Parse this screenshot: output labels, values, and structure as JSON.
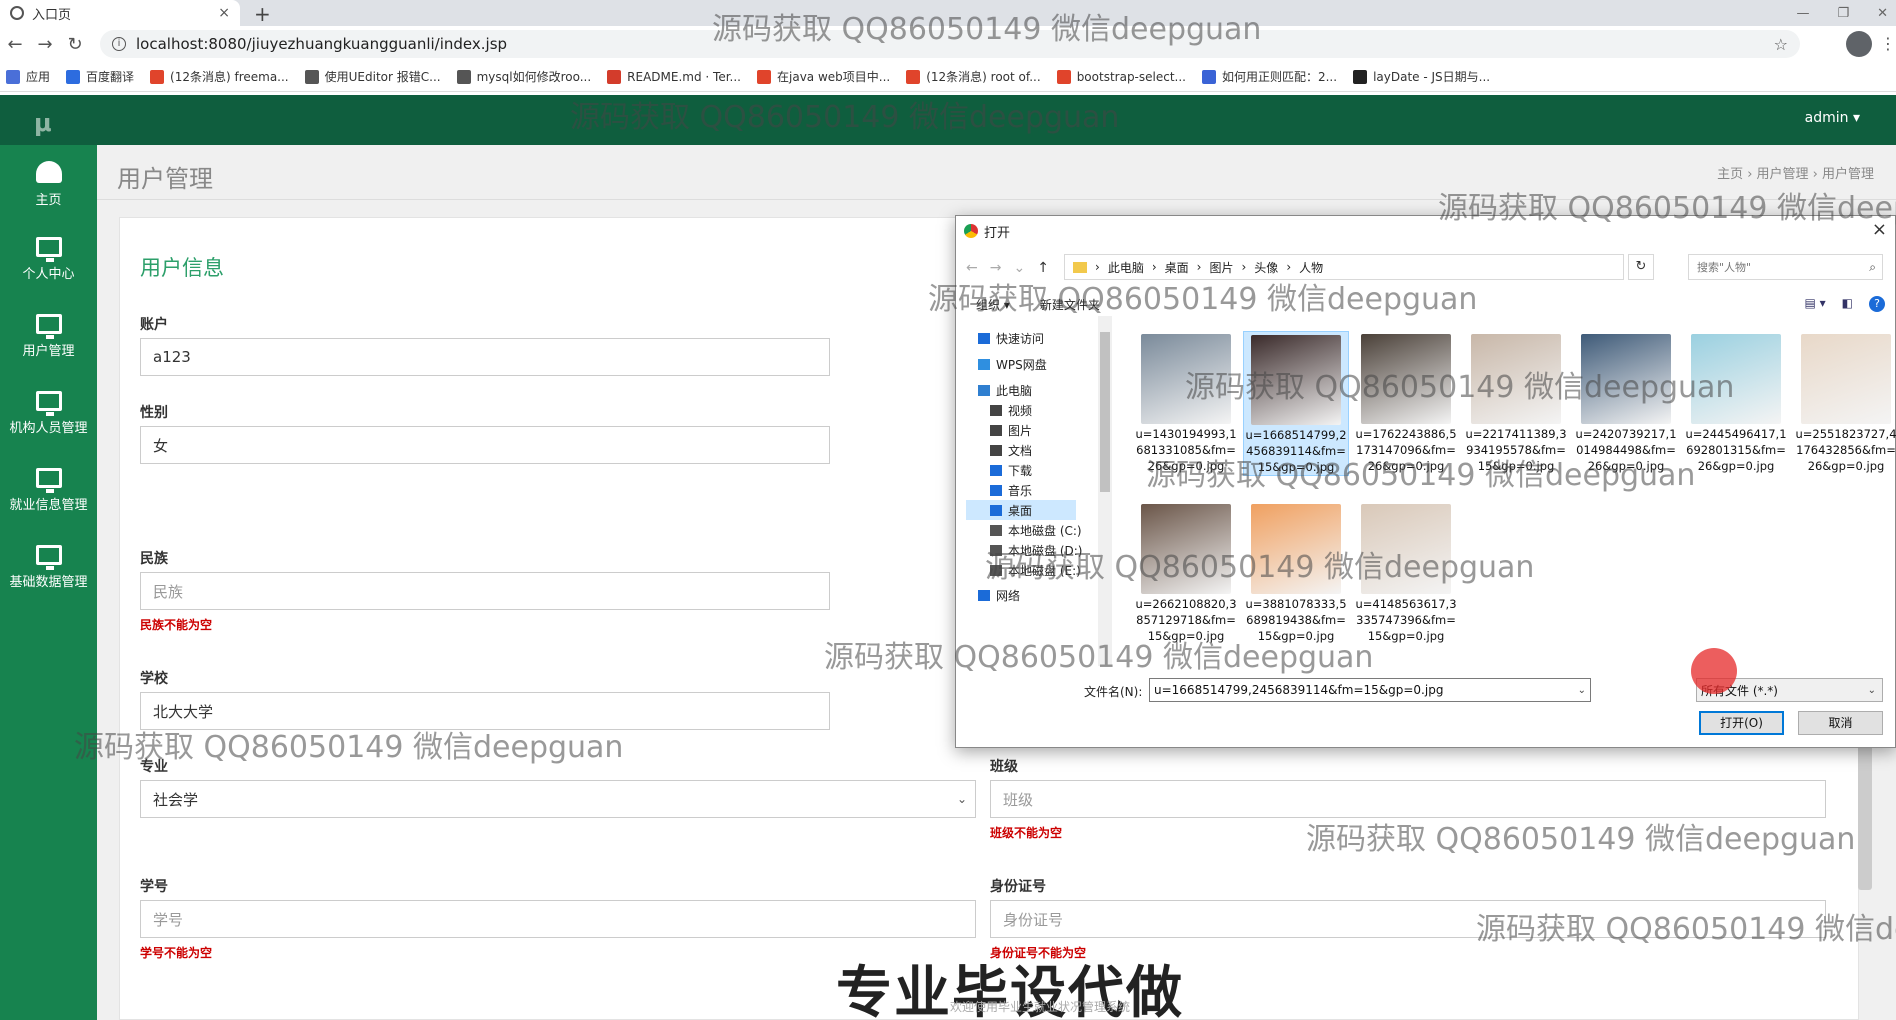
{
  "browser": {
    "tab_title": "入口页",
    "tab_close": "×",
    "new_tab": "+",
    "url": "localhost:8080/jiuyezhuangkuangguanli/index.jsp",
    "bookmarks": [
      {
        "label": "应用",
        "color": "#4a6fd8"
      },
      {
        "label": "百度翻译",
        "color": "#2d6cdf"
      },
      {
        "label": "(12条消息) freema...",
        "color": "#e0442b"
      },
      {
        "label": "使用UEditor 报错C...",
        "color": "#555555"
      },
      {
        "label": "mysql如何修改roo...",
        "color": "#555555"
      },
      {
        "label": "README.md · Ter...",
        "color": "#d33c2b"
      },
      {
        "label": "在java web项目中...",
        "color": "#e0442b"
      },
      {
        "label": "(12条消息) root of...",
        "color": "#e0442b"
      },
      {
        "label": "bootstrap-select...",
        "color": "#e0442b"
      },
      {
        "label": "如何用正则匹配：2...",
        "color": "#3a63d6"
      },
      {
        "label": "layDate - JS日期与...",
        "color": "#222222"
      }
    ]
  },
  "watermark_text": "源码获取 QQ86050149 微信deepguan",
  "app": {
    "logo": "μ",
    "user_menu": "admin ▾",
    "sidebar": [
      {
        "label": "主页",
        "icon": "dashboard-icon"
      },
      {
        "label": "个人中心",
        "icon": "monitor-icon"
      },
      {
        "label": "用户管理",
        "icon": "monitor-icon"
      },
      {
        "label": "机构人员管理",
        "icon": "monitor-icon"
      },
      {
        "label": "就业信息管理",
        "icon": "monitor-icon"
      },
      {
        "label": "基础数据管理",
        "icon": "monitor-icon"
      }
    ],
    "page_title": "用户管理",
    "breadcrumb": "主页 › 用户管理 › 用户管理",
    "section_title": "用户信息",
    "form": {
      "account_label": "账户",
      "account_value": "a123",
      "gender_label": "性别",
      "gender_value": "女",
      "ethnicity_label": "民族",
      "ethnicity_placeholder": "民族",
      "ethnicity_error": "民族不能为空",
      "school_label": "学校",
      "school_value": "北大大学",
      "major_label": "专业",
      "major_value": "社会学",
      "class_label": "班级",
      "class_placeholder": "班级",
      "class_error": "班级不能为空",
      "student_no_label": "学号",
      "student_no_placeholder": "学号",
      "student_no_error": "学号不能为空",
      "id_card_label": "身份证号",
      "id_card_placeholder": "身份证号",
      "id_card_error": "身份证号不能为空"
    },
    "bottom_caption": "专业毕设代做",
    "footer_note": "欢迎使用毕业生就业状况管理系统"
  },
  "dialog": {
    "title": "打开",
    "close": "×",
    "path": [
      "此电脑",
      "桌面",
      "图片",
      "头像",
      "人物"
    ],
    "search_placeholder": "搜索\"人物\"",
    "organize": "组织 ▾",
    "new_folder": "新建文件夹",
    "tree": [
      {
        "label": "快速访问",
        "color": "#1b6bd8"
      },
      {
        "label": "WPS网盘",
        "color": "#2f8fe0"
      },
      {
        "label": "此电脑",
        "color": "#2f7fd0"
      },
      {
        "label": "视频",
        "color": "#444444"
      },
      {
        "label": "图片",
        "color": "#444444"
      },
      {
        "label": "文档",
        "color": "#444444"
      },
      {
        "label": "下载",
        "color": "#1b6bd8"
      },
      {
        "label": "音乐",
        "color": "#1b6bd8"
      },
      {
        "label": "桌面",
        "color": "#1b6bd8"
      },
      {
        "label": "本地磁盘 (C:)",
        "color": "#555555"
      },
      {
        "label": "本地磁盘 (D:)",
        "color": "#555555"
      },
      {
        "label": "本地磁盘 (E:)",
        "color": "#555555"
      },
      {
        "label": "网络",
        "color": "#1b6bd8"
      }
    ],
    "files": [
      {
        "name": "u=1430194993,1681331085&fm=26&gp=0.jpg",
        "color": "#7a8a9a"
      },
      {
        "name": "u=1668514799,2456839114&fm=15&gp=0.jpg",
        "color": "#3a2a2a"
      },
      {
        "name": "u=1762243886,5173147096&fm=26&gp=0.jpg",
        "color": "#4a4038"
      },
      {
        "name": "u=2217411389,3934195578&fm=15&gp=0.jpg",
        "color": "#c8b7a8"
      },
      {
        "name": "u=2420739217,1014984498&fm=26&gp=0.jpg",
        "color": "#3e5a78"
      },
      {
        "name": "u=2445496417,1692801315&fm=26&gp=0.jpg",
        "color": "#9ad0e0"
      },
      {
        "name": "u=2551823727,4176432856&fm=26&gp=0.jpg",
        "color": "#e8d8c8"
      },
      {
        "name": "u=2662108820,3857129718&fm=15&gp=0.jpg",
        "color": "#6a5548"
      },
      {
        "name": "u=3881078333,5689819438&fm=15&gp=0.jpg",
        "color": "#f0a060"
      },
      {
        "name": "u=4148563617,3335747396&fm=15&gp=0.jpg",
        "color": "#d9c8b8"
      }
    ],
    "filename_label": "文件名(N):",
    "filename_value": "u=1668514799,2456839114&fm=15&gp=0.jpg",
    "filetype_value": "所有文件 (*.*)",
    "open_button": "打开(O)",
    "cancel_button": "取消"
  }
}
